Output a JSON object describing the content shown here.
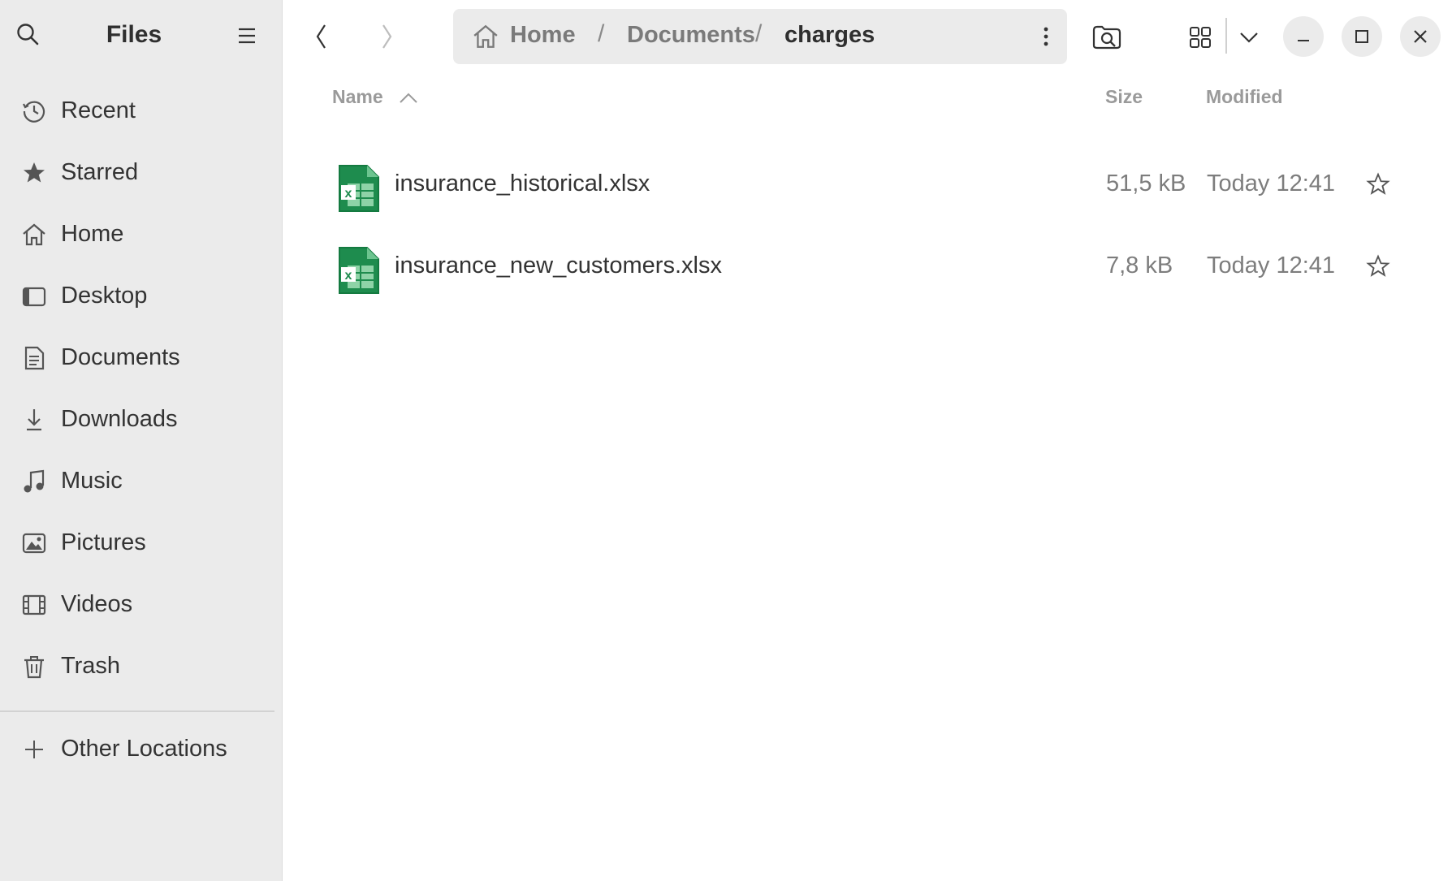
{
  "sidebar": {
    "title": "Files",
    "items": [
      {
        "label": "Recent",
        "icon": "clock-icon"
      },
      {
        "label": "Starred",
        "icon": "star-icon"
      },
      {
        "label": "Home",
        "icon": "home-icon"
      },
      {
        "label": "Desktop",
        "icon": "desktop-icon"
      },
      {
        "label": "Documents",
        "icon": "document-icon"
      },
      {
        "label": "Downloads",
        "icon": "download-icon"
      },
      {
        "label": "Music",
        "icon": "music-icon"
      },
      {
        "label": "Pictures",
        "icon": "picture-icon"
      },
      {
        "label": "Videos",
        "icon": "video-icon"
      },
      {
        "label": "Trash",
        "icon": "trash-icon"
      }
    ],
    "other_locations": "Other Locations"
  },
  "pathbar": {
    "crumbs": [
      "Home",
      "Documents",
      "charges"
    ],
    "separator": "/"
  },
  "columns": {
    "name": "Name",
    "size": "Size",
    "modified": "Modified"
  },
  "files": [
    {
      "name": "insurance_historical.xlsx",
      "size": "51,5 kB",
      "modified": "Today 12:41",
      "icon": "spreadsheet-icon"
    },
    {
      "name": "insurance_new_customers.xlsx",
      "size": "7,8 kB",
      "modified": "Today 12:41",
      "icon": "spreadsheet-icon"
    }
  ],
  "colors": {
    "sidebar_bg": "#ebebeb",
    "spreadsheet_green": "#1e8c4e"
  }
}
